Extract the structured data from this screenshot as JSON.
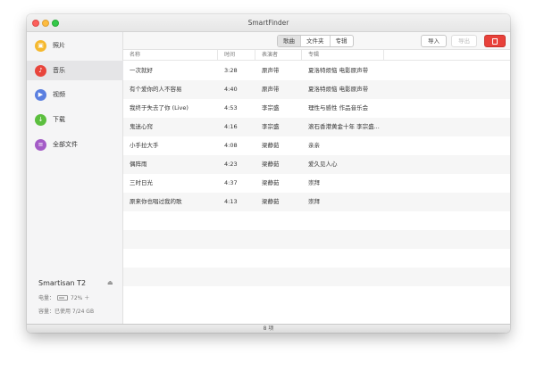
{
  "window": {
    "title": "SmartFinder"
  },
  "sidebar": {
    "items": [
      {
        "label": "照片",
        "icon": "photo-icon",
        "glyph": "▣",
        "color": "#f5b82e"
      },
      {
        "label": "音乐",
        "icon": "music-note-icon",
        "glyph": "♪",
        "color": "#e8453c",
        "active": true
      },
      {
        "label": "视频",
        "icon": "play-icon",
        "glyph": "▶",
        "color": "#5a7fe0"
      },
      {
        "label": "下载",
        "icon": "download-icon",
        "glyph": "↓",
        "color": "#5cbf3f"
      },
      {
        "label": "全部文件",
        "icon": "files-icon",
        "glyph": "≡",
        "color": "#a45cc7"
      }
    ],
    "device": {
      "name": "Smartisan T2",
      "battery_label": "电量：",
      "battery_value": "72% ＋",
      "battery_level": 0.72,
      "storage": "容量：已使用 7/24 GB"
    }
  },
  "toolbar": {
    "segments": [
      {
        "label": "歌曲",
        "active": true
      },
      {
        "label": "文件夹"
      },
      {
        "label": "专辑"
      }
    ],
    "import_label": "导入",
    "export_label": "导出"
  },
  "table": {
    "headers": [
      "名称",
      "时间",
      "表演者",
      "专辑"
    ],
    "rows": [
      [
        "一次就好",
        "3:28",
        "原声带",
        "夏洛特烦恼 电影原声带"
      ],
      [
        "有个爱你的人不容易",
        "4:40",
        "原声带",
        "夏洛特烦恼 电影原声带"
      ],
      [
        "我终于失去了你 (Live)",
        "4:53",
        "李宗盛",
        "理性与感性 作品音乐会"
      ],
      [
        "鬼迷心窍",
        "4:16",
        "李宗盛",
        "滚石香港黄金十年 李宗盛..."
      ],
      [
        "小手拉大手",
        "4:08",
        "梁静茹",
        "亲亲"
      ],
      [
        "偶阵雨",
        "4:23",
        "梁静茹",
        "爱久见人心"
      ],
      [
        "三时日光",
        "4:37",
        "梁静茹",
        "崇拜"
      ],
      [
        "原来你也唱过我的歌",
        "4:13",
        "梁静茹",
        "崇拜"
      ]
    ]
  },
  "status": {
    "count": "8 项"
  }
}
